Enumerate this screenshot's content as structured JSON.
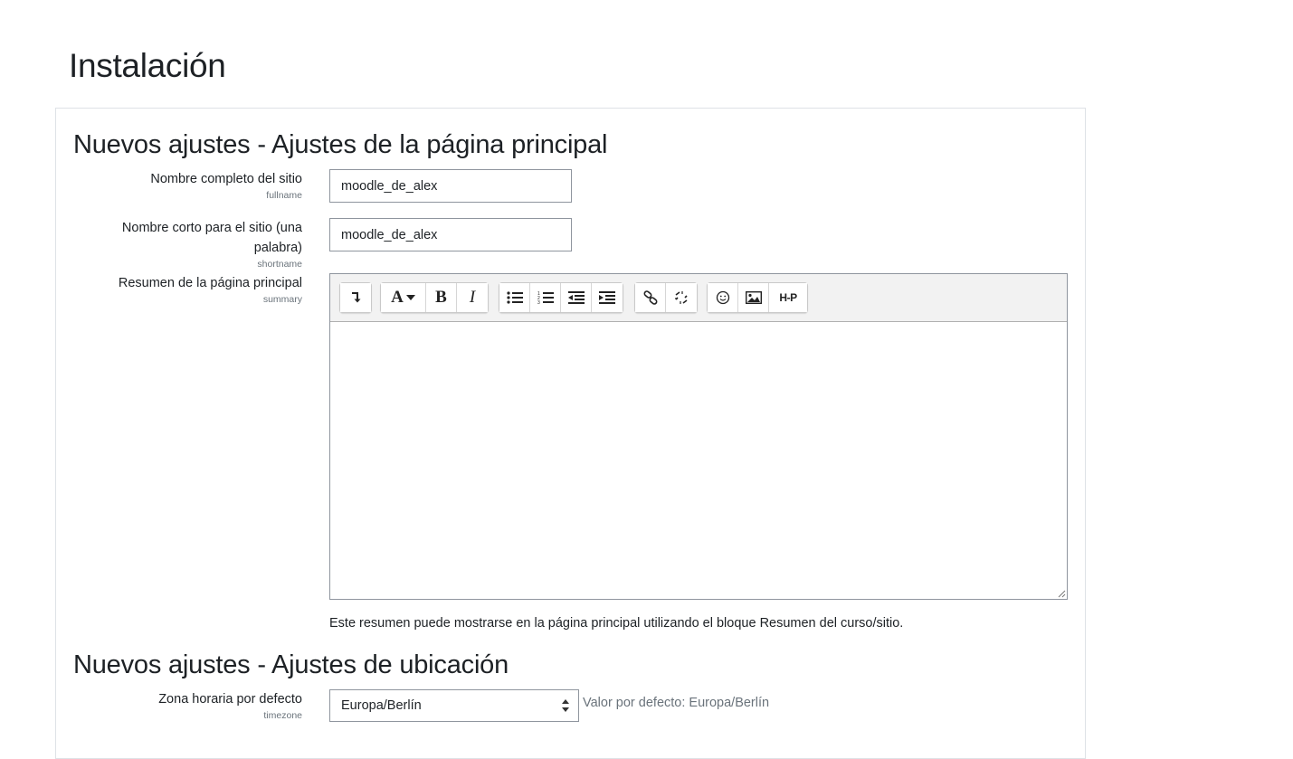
{
  "page": {
    "title": "Instalación"
  },
  "sections": {
    "frontpage": {
      "heading": "Nuevos ajustes - Ajustes de la página principal",
      "fullname": {
        "label": "Nombre completo del sitio",
        "setting": "fullname",
        "value": "moodle_de_alex"
      },
      "shortname": {
        "label_line1": "Nombre corto para el sitio (una",
        "label_line2": "palabra)",
        "setting": "shortname",
        "value": "moodle_de_alex"
      },
      "summary": {
        "label": "Resumen de la página principal",
        "setting": "summary",
        "help": "Este resumen puede mostrarse en la página principal utilizando el bloque Resumen del curso/sitio.",
        "toolbar": [
          "show-more-icon",
          "font-color-icon",
          "bold-icon",
          "italic-icon",
          "unordered-list-icon",
          "ordered-list-icon",
          "outdent-icon",
          "indent-icon",
          "link-icon",
          "unlink-icon",
          "emoji-icon",
          "image-icon",
          "h5p-icon"
        ],
        "h5p_label": "H-P"
      }
    },
    "location": {
      "heading": "Nuevos ajustes - Ajustes de ubicación",
      "timezone": {
        "label": "Zona horaria por defecto",
        "setting": "timezone",
        "value": "Europa/Berlín",
        "default_text": "Valor por defecto: Europa/Berlín"
      }
    }
  }
}
